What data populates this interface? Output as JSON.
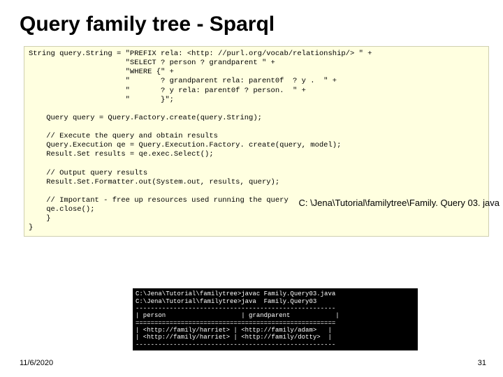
{
  "title": "Query family tree - Sparql",
  "code": "String query.String = \"PREFIX rela: <http: //purl.org/vocab/relationship/> \" +\n                      \"SELECT ? person ? grandparent \" +\n                      \"WHERE {\" +\n                      \"       ? grandparent rela: parent0f  ? y .  \" +\n                      \"       ? y rela: parent0f ? person.  \" +\n                      \"       }\";\n\n    Query query = Query.Factory.create(query.String);\n\n    // Execute the query and obtain results\n    Query.Execution qe = Query.Execution.Factory. create(query, model);\n    Result.Set results = qe.exec.Select();\n\n    // Output query results\n    Result.Set.Formatter.out(System.out, results, query);\n\n    // Important - free up resources used running the query\n    qe.close();\n    }\n}",
  "file_path": "C: \\Jena\\Tutorial\\familytree\\Family. Query 03. java",
  "terminal": "C:\\Jena\\Tutorial\\familytree>javac Family.Query03.java\nC:\\Jena\\Tutorial\\familytree>java  Family.Query03\n-----------------------------------------------------\n| person                    | grandparent            |\n=====================================================\n| <http://family/harriet> | <http://family/adam>   |\n| <http://family/harriet> | <http://family/dotty>  |\n-----------------------------------------------------",
  "footer_date": "11/6/2020",
  "footer_page": "31"
}
